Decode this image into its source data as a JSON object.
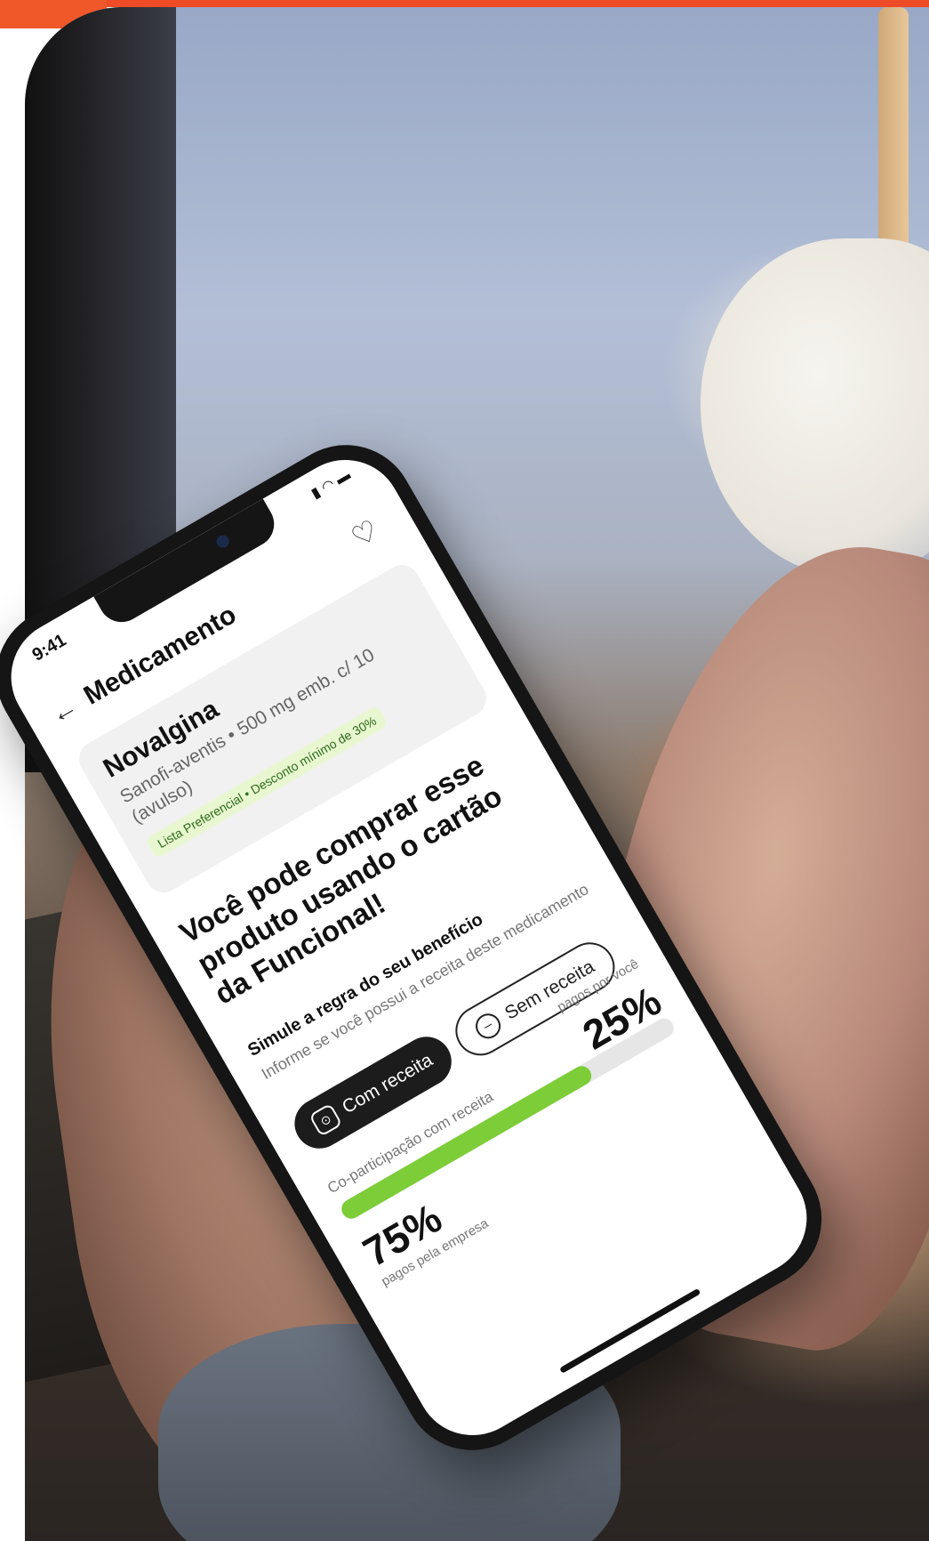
{
  "accent": "#ef4b27",
  "phone": {
    "status": {
      "time": "9:41",
      "icons": [
        "signal-icon",
        "wifi-icon",
        "battery-icon"
      ]
    },
    "header": {
      "title": "Medicamento",
      "back_icon": "arrow-left-icon",
      "favorite_icon": "heart-outline-icon"
    },
    "product": {
      "name": "Novalgina",
      "description": "Sanofi-aventis • 500 mg emb. c/ 10 (avulso)",
      "tag": "Lista Preferencial • Desconto mínimo de 30%"
    },
    "headline": "Você pode comprar esse produto usando o cartão da Funcional!",
    "simulate": {
      "title": "Simule a regra do seu benefício",
      "subtitle": "Informe se você possui a receita deste medicamento",
      "option_with": "Com receita",
      "option_without": "Sem receita",
      "selected": "Com receita"
    },
    "copay": {
      "label": "Co-participação com receita",
      "company_pct": 0.75,
      "company_value": "75%",
      "company_caption": "pagos pela empresa",
      "user_value": "25%",
      "user_caption": "pagos por você",
      "bar_color": "#7ccd38"
    }
  }
}
